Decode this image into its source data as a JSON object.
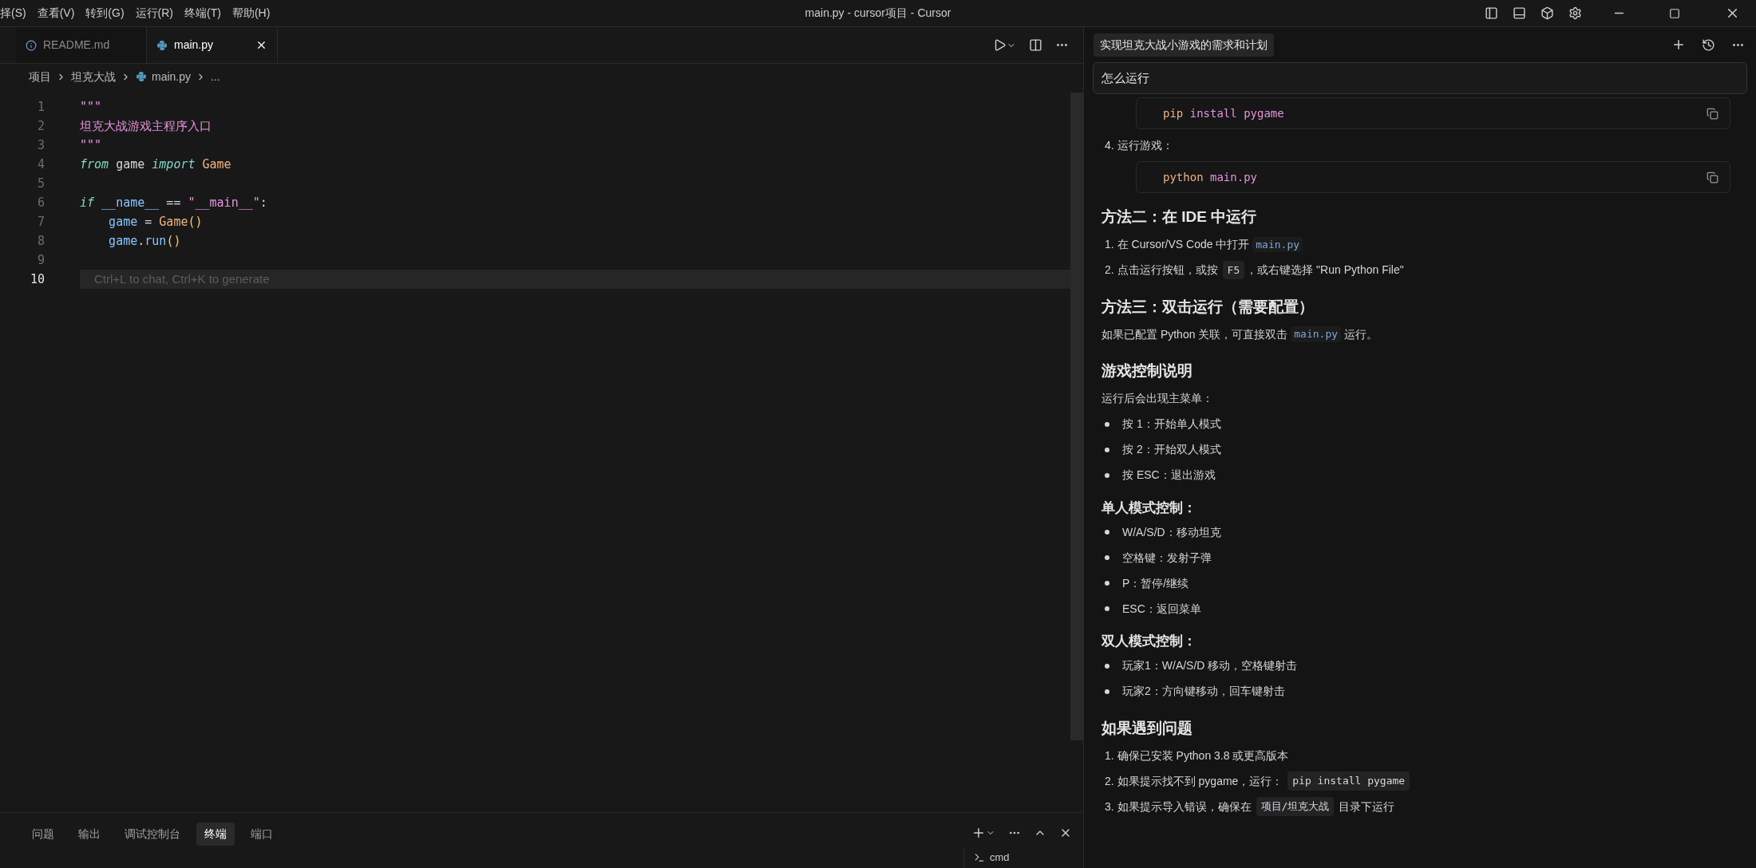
{
  "menu": [
    "择(S)",
    "查看(V)",
    "转到(G)",
    "运行(R)",
    "终端(T)",
    "帮助(H)"
  ],
  "window": {
    "title": "main.py - cursor项目 - Cursor"
  },
  "tabs": [
    {
      "label": "README.md",
      "kind": "info",
      "selected": false
    },
    {
      "label": "main.py",
      "kind": "python",
      "selected": true
    }
  ],
  "breadcrumb": [
    {
      "label": "项目",
      "kind": "folder"
    },
    {
      "label": "坦克大战",
      "kind": "folder"
    },
    {
      "label": "main.py",
      "kind": "python"
    },
    {
      "label": "...",
      "kind": "symbol"
    }
  ],
  "code": [
    {
      "number": "1",
      "current": false,
      "tokens": [
        {
          "kind": "string",
          "text": "\"\"\""
        }
      ]
    },
    {
      "number": "2",
      "current": false,
      "tokens": [
        {
          "kind": "string",
          "text": "坦克大战游戏主程序入口"
        }
      ]
    },
    {
      "number": "3",
      "current": false,
      "tokens": [
        {
          "kind": "string",
          "text": "\"\"\""
        }
      ]
    },
    {
      "number": "4",
      "current": false,
      "tokens": [
        {
          "kind": "keyword",
          "text": "from"
        },
        {
          "kind": "plain",
          "text": " game "
        },
        {
          "kind": "keyword",
          "text": "import"
        },
        {
          "kind": "class",
          "text": " Game"
        }
      ]
    },
    {
      "number": "5",
      "current": false
    },
    {
      "number": "6",
      "current": false,
      "tokens": [
        {
          "kind": "keyword",
          "text": "if"
        },
        {
          "kind": "variable",
          "text": " __name__"
        },
        {
          "kind": "plain",
          "text": " == "
        },
        {
          "kind": "string",
          "text": "\"__main__\""
        },
        {
          "kind": "plain",
          "text": ":"
        }
      ]
    },
    {
      "number": "7",
      "current": false,
      "tokens": [
        {
          "kind": "variable",
          "text": "    game"
        },
        {
          "kind": "plain",
          "text": " = "
        },
        {
          "kind": "class",
          "text": "Game"
        },
        {
          "kind": "paren",
          "text": "()"
        }
      ]
    },
    {
      "number": "8",
      "current": false,
      "tokens": [
        {
          "kind": "variable",
          "text": "    game"
        },
        {
          "kind": "plain",
          "text": "."
        },
        {
          "kind": "variable",
          "text": "run"
        },
        {
          "kind": "paren",
          "text": "()"
        }
      ]
    },
    {
      "number": "9",
      "current": false
    },
    {
      "number": "10",
      "current": true,
      "hint": "Ctrl+L to chat, Ctrl+K to generate"
    }
  ],
  "panel_tabs": [
    {
      "label": "问题",
      "selected": false
    },
    {
      "label": "输出",
      "selected": false
    },
    {
      "label": "调试控制台",
      "selected": false
    },
    {
      "label": "终端",
      "selected": true
    },
    {
      "label": "端口",
      "selected": false
    }
  ],
  "terminal_list": [
    {
      "label": "cmd"
    }
  ],
  "chat": {
    "title": "实现坦克大战小游戏的需求和计划",
    "query": "怎么运行",
    "blocks": [
      {
        "kind": "code",
        "tokens": [
          {
            "kind": "command",
            "text": "pip"
          },
          {
            "kind": "arg",
            "text": " install pygame"
          }
        ]
      },
      {
        "kind": "numbered",
        "marker": "4.",
        "segments": [
          {
            "kind": "text",
            "text": "运行游戏："
          }
        ]
      },
      {
        "kind": "code",
        "tokens": [
          {
            "kind": "command",
            "text": "python"
          },
          {
            "kind": "arg",
            "text": " main.py"
          }
        ]
      },
      {
        "kind": "heading",
        "text": "方法二：在 IDE 中运行"
      },
      {
        "kind": "numbered",
        "marker": "1.",
        "segments": [
          {
            "kind": "text",
            "text": "在 Cursor/VS Code 中打开 "
          },
          {
            "kind": "link",
            "text": "main.py"
          }
        ]
      },
      {
        "kind": "numbered",
        "marker": "2.",
        "segments": [
          {
            "kind": "text",
            "text": "点击运行按钮，或按 "
          },
          {
            "kind": "code",
            "text": "F5"
          },
          {
            "kind": "text",
            "text": "，或右键选择 \"Run Python File\""
          }
        ]
      },
      {
        "kind": "heading",
        "text": "方法三：双击运行（需要配置）"
      },
      {
        "kind": "paragraph",
        "segments": [
          {
            "kind": "text",
            "text": "如果已配置 Python 关联，可直接双击 "
          },
          {
            "kind": "link",
            "text": "main.py"
          },
          {
            "kind": "text",
            "text": " 运行。"
          }
        ]
      },
      {
        "kind": "heading",
        "text": "游戏控制说明"
      },
      {
        "kind": "paragraph",
        "segments": [
          {
            "kind": "text",
            "text": "运行后会出现主菜单："
          }
        ]
      },
      {
        "kind": "bullet",
        "segments": [
          {
            "kind": "text",
            "text": "按 1：开始单人模式"
          }
        ]
      },
      {
        "kind": "bullet",
        "segments": [
          {
            "kind": "text",
            "text": "按 2：开始双人模式"
          }
        ]
      },
      {
        "kind": "bullet",
        "segments": [
          {
            "kind": "text",
            "text": "按 ESC：退出游戏"
          }
        ]
      },
      {
        "kind": "subheading",
        "text": "单人模式控制："
      },
      {
        "kind": "bullet",
        "segments": [
          {
            "kind": "text",
            "text": "W/A/S/D：移动坦克"
          }
        ]
      },
      {
        "kind": "bullet",
        "segments": [
          {
            "kind": "text",
            "text": "空格键：发射子弹"
          }
        ]
      },
      {
        "kind": "bullet",
        "segments": [
          {
            "kind": "text",
            "text": "P：暂停/继续"
          }
        ]
      },
      {
        "kind": "bullet",
        "segments": [
          {
            "kind": "text",
            "text": "ESC：返回菜单"
          }
        ]
      },
      {
        "kind": "subheading",
        "text": "双人模式控制："
      },
      {
        "kind": "bullet",
        "segments": [
          {
            "kind": "text",
            "text": "玩家1：W/A/S/D 移动，空格键射击"
          }
        ]
      },
      {
        "kind": "bullet",
        "segments": [
          {
            "kind": "text",
            "text": "玩家2：方向键移动，回车键射击"
          }
        ]
      },
      {
        "kind": "heading",
        "text": "如果遇到问题"
      },
      {
        "kind": "numbered",
        "marker": "1.",
        "segments": [
          {
            "kind": "text",
            "text": "确保已安装 Python 3.8 或更高版本"
          }
        ]
      },
      {
        "kind": "numbered",
        "marker": "2.",
        "segments": [
          {
            "kind": "text",
            "text": "如果提示找不到 pygame，运行： "
          },
          {
            "kind": "code",
            "text": "pip install pygame"
          }
        ]
      },
      {
        "kind": "numbered",
        "marker": "3.",
        "segments": [
          {
            "kind": "text",
            "text": "如果提示导入错误，确保在 "
          },
          {
            "kind": "code",
            "text": "项目/坦克大战"
          },
          {
            "kind": "text",
            "text": " 目录下运行"
          }
        ]
      }
    ]
  }
}
